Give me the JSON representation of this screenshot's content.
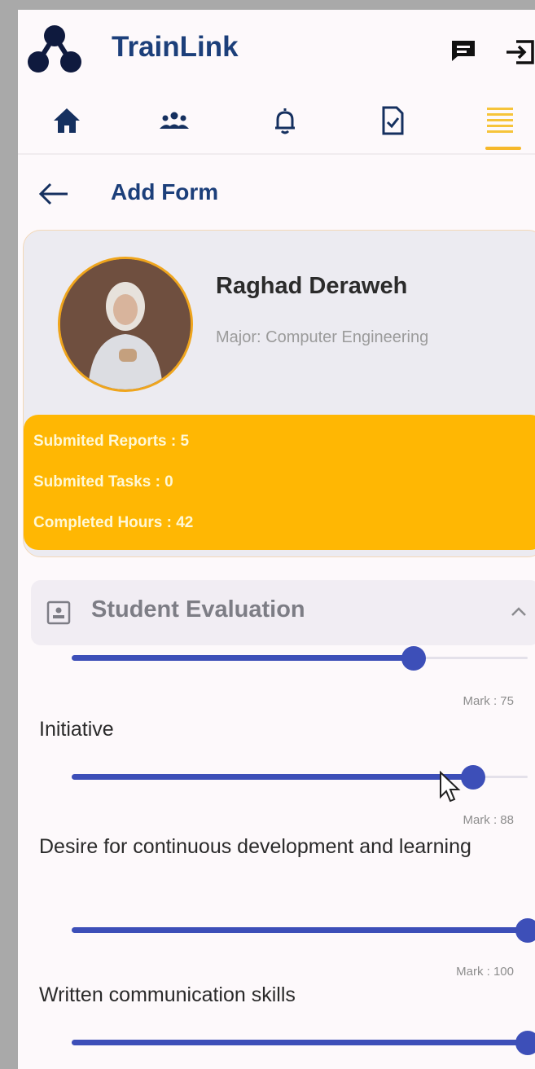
{
  "app": {
    "title": "TrainLink"
  },
  "nav": [
    {
      "name": "home",
      "icon": "home-icon"
    },
    {
      "name": "people",
      "icon": "people-icon"
    },
    {
      "name": "notifications",
      "icon": "bell-icon"
    },
    {
      "name": "tasks",
      "icon": "document-check-icon"
    },
    {
      "name": "menu",
      "icon": "menu-icon"
    }
  ],
  "page": {
    "title": "Add Form"
  },
  "profile": {
    "name": "Raghad Deraweh",
    "major": "Major: Computer Engineering",
    "stats": [
      "Submited Reports : 5",
      "Submited Tasks : 0",
      "Completed Hours : 42"
    ]
  },
  "evaluation": {
    "title": "Student Evaluation",
    "previous_slider": {
      "value": 75,
      "mark": "Mark : 75"
    },
    "criteria": [
      {
        "label": "Initiative",
        "value": 88,
        "mark": "Mark : 88"
      },
      {
        "label": "Desire for continuous development and learning",
        "value": 100,
        "mark": "Mark : 100"
      },
      {
        "label": "Written communication skills",
        "value": 100
      }
    ]
  },
  "colors": {
    "brand_blue": "#1c3f7a",
    "accent_yellow": "#ffb703",
    "slider": "#3d4fb8"
  }
}
